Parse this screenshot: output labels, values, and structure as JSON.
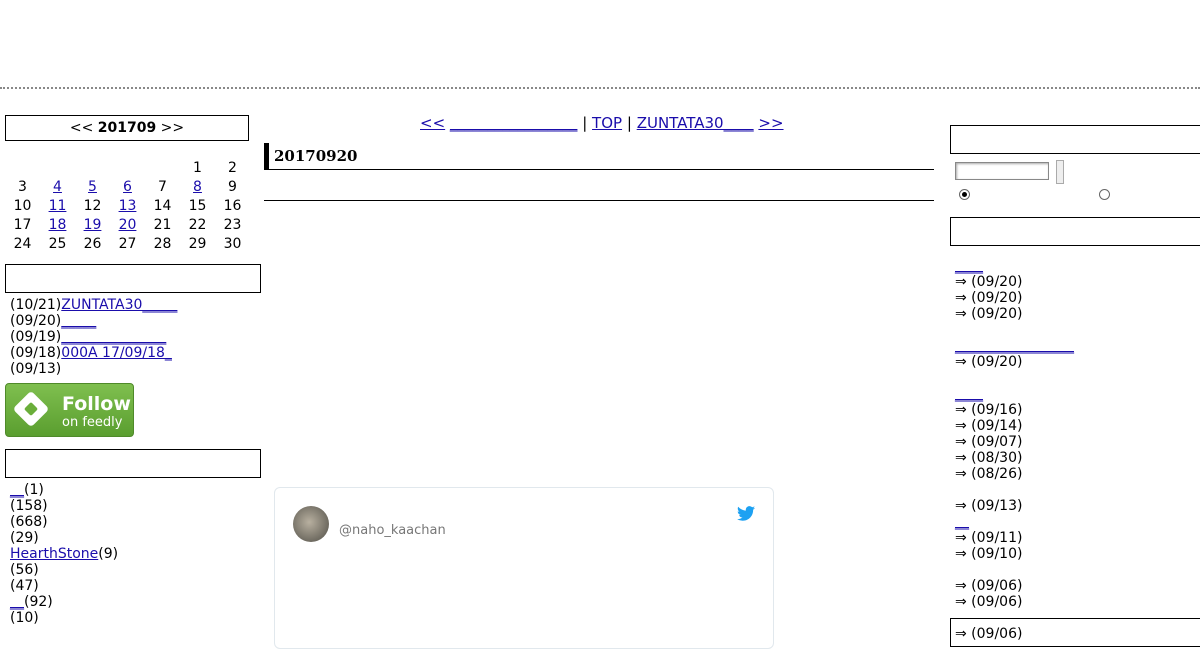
{
  "calendar": {
    "prev": "<<",
    "month": "201709",
    "next": ">>",
    "weeks": [
      [
        "",
        "",
        "",
        "",
        "",
        "1",
        "2"
      ],
      [
        "3",
        "4",
        "5",
        "6",
        "7",
        "8",
        "9"
      ],
      [
        "10",
        "11",
        "12",
        "13",
        "14",
        "15",
        "16"
      ],
      [
        "17",
        "18",
        "19",
        "20",
        "21",
        "22",
        "23"
      ],
      [
        "24",
        "25",
        "26",
        "27",
        "28",
        "29",
        "30"
      ]
    ],
    "linked_days": [
      "4",
      "5",
      "6",
      "8",
      "11",
      "13",
      "18",
      "19",
      "20"
    ]
  },
  "recent_posts": [
    {
      "date": "(10/21)",
      "title": "ZUNTATA30_____"
    },
    {
      "date": "(09/20)",
      "title": "_____"
    },
    {
      "date": "(09/19)",
      "title": "_______________"
    },
    {
      "date": "(09/18)",
      "title": "000A 17/09/18_"
    },
    {
      "date": "(09/13)",
      "title": ""
    }
  ],
  "feedly": {
    "follow": "Follow",
    "on": "on feedly"
  },
  "categories": [
    {
      "name": "__",
      "count": "(1)"
    },
    {
      "name": "",
      "count": "(158)"
    },
    {
      "name": "",
      "count": "(668)"
    },
    {
      "name": "",
      "count": "(29)"
    },
    {
      "name": "HearthStone",
      "count": "(9)"
    },
    {
      "name": "",
      "count": "(56)"
    },
    {
      "name": "",
      "count": "(47)"
    },
    {
      "name": "__",
      "count": "(92)"
    },
    {
      "name": "",
      "count": "(10)"
    }
  ],
  "nav": {
    "prev": "<<",
    "prev_title": "_________________",
    "sep1": "|",
    "top": "TOP",
    "sep2": "|",
    "next_title": "ZUNTATA30____",
    "next": ">>"
  },
  "entry": {
    "date": "20170920"
  },
  "tweet": {
    "handle": "@naho_kaachan"
  },
  "right_list": [
    {
      "type": "link",
      "text": "____"
    },
    {
      "type": "item",
      "text": "⇒  (09/20)"
    },
    {
      "type": "item",
      "text": "⇒  (09/20)"
    },
    {
      "type": "item",
      "text": "⇒  (09/20)"
    },
    {
      "type": "gap"
    },
    {
      "type": "link",
      "text": "_________________"
    },
    {
      "type": "item",
      "text": "⇒  (09/20)"
    },
    {
      "type": "gap"
    },
    {
      "type": "link",
      "text": "____"
    },
    {
      "type": "item",
      "text": "⇒  (09/16)"
    },
    {
      "type": "item",
      "text": "⇒  (09/14)"
    },
    {
      "type": "item",
      "text": "⇒  (09/07)"
    },
    {
      "type": "item",
      "text": "⇒  (08/30)"
    },
    {
      "type": "item",
      "text": "⇒  (08/26)"
    },
    {
      "type": "gap"
    },
    {
      "type": "item",
      "text": "⇒  (09/13)"
    },
    {
      "type": "link",
      "text": "__"
    },
    {
      "type": "item",
      "text": "⇒  (09/11)"
    },
    {
      "type": "item",
      "text": "⇒  (09/10)"
    },
    {
      "type": "gap"
    },
    {
      "type": "item",
      "text": "⇒  (09/06)"
    },
    {
      "type": "item",
      "text": "⇒  (09/06)"
    },
    {
      "type": "gap"
    },
    {
      "type": "item",
      "text": "⇒ (09/06)"
    }
  ]
}
